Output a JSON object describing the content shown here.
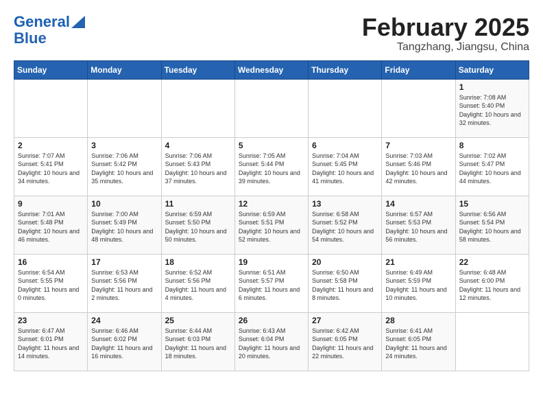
{
  "header": {
    "logo_line1": "General",
    "logo_line2": "Blue",
    "month_year": "February 2025",
    "location": "Tangzhang, Jiangsu, China"
  },
  "days_of_week": [
    "Sunday",
    "Monday",
    "Tuesday",
    "Wednesday",
    "Thursday",
    "Friday",
    "Saturday"
  ],
  "weeks": [
    [
      {
        "day": "",
        "info": ""
      },
      {
        "day": "",
        "info": ""
      },
      {
        "day": "",
        "info": ""
      },
      {
        "day": "",
        "info": ""
      },
      {
        "day": "",
        "info": ""
      },
      {
        "day": "",
        "info": ""
      },
      {
        "day": "1",
        "info": "Sunrise: 7:08 AM\nSunset: 5:40 PM\nDaylight: 10 hours and 32 minutes."
      }
    ],
    [
      {
        "day": "2",
        "info": "Sunrise: 7:07 AM\nSunset: 5:41 PM\nDaylight: 10 hours and 34 minutes."
      },
      {
        "day": "3",
        "info": "Sunrise: 7:06 AM\nSunset: 5:42 PM\nDaylight: 10 hours and 35 minutes."
      },
      {
        "day": "4",
        "info": "Sunrise: 7:06 AM\nSunset: 5:43 PM\nDaylight: 10 hours and 37 minutes."
      },
      {
        "day": "5",
        "info": "Sunrise: 7:05 AM\nSunset: 5:44 PM\nDaylight: 10 hours and 39 minutes."
      },
      {
        "day": "6",
        "info": "Sunrise: 7:04 AM\nSunset: 5:45 PM\nDaylight: 10 hours and 41 minutes."
      },
      {
        "day": "7",
        "info": "Sunrise: 7:03 AM\nSunset: 5:46 PM\nDaylight: 10 hours and 42 minutes."
      },
      {
        "day": "8",
        "info": "Sunrise: 7:02 AM\nSunset: 5:47 PM\nDaylight: 10 hours and 44 minutes."
      }
    ],
    [
      {
        "day": "9",
        "info": "Sunrise: 7:01 AM\nSunset: 5:48 PM\nDaylight: 10 hours and 46 minutes."
      },
      {
        "day": "10",
        "info": "Sunrise: 7:00 AM\nSunset: 5:49 PM\nDaylight: 10 hours and 48 minutes."
      },
      {
        "day": "11",
        "info": "Sunrise: 6:59 AM\nSunset: 5:50 PM\nDaylight: 10 hours and 50 minutes."
      },
      {
        "day": "12",
        "info": "Sunrise: 6:59 AM\nSunset: 5:51 PM\nDaylight: 10 hours and 52 minutes."
      },
      {
        "day": "13",
        "info": "Sunrise: 6:58 AM\nSunset: 5:52 PM\nDaylight: 10 hours and 54 minutes."
      },
      {
        "day": "14",
        "info": "Sunrise: 6:57 AM\nSunset: 5:53 PM\nDaylight: 10 hours and 56 minutes."
      },
      {
        "day": "15",
        "info": "Sunrise: 6:56 AM\nSunset: 5:54 PM\nDaylight: 10 hours and 58 minutes."
      }
    ],
    [
      {
        "day": "16",
        "info": "Sunrise: 6:54 AM\nSunset: 5:55 PM\nDaylight: 11 hours and 0 minutes."
      },
      {
        "day": "17",
        "info": "Sunrise: 6:53 AM\nSunset: 5:56 PM\nDaylight: 11 hours and 2 minutes."
      },
      {
        "day": "18",
        "info": "Sunrise: 6:52 AM\nSunset: 5:56 PM\nDaylight: 11 hours and 4 minutes."
      },
      {
        "day": "19",
        "info": "Sunrise: 6:51 AM\nSunset: 5:57 PM\nDaylight: 11 hours and 6 minutes."
      },
      {
        "day": "20",
        "info": "Sunrise: 6:50 AM\nSunset: 5:58 PM\nDaylight: 11 hours and 8 minutes."
      },
      {
        "day": "21",
        "info": "Sunrise: 6:49 AM\nSunset: 5:59 PM\nDaylight: 11 hours and 10 minutes."
      },
      {
        "day": "22",
        "info": "Sunrise: 6:48 AM\nSunset: 6:00 PM\nDaylight: 11 hours and 12 minutes."
      }
    ],
    [
      {
        "day": "23",
        "info": "Sunrise: 6:47 AM\nSunset: 6:01 PM\nDaylight: 11 hours and 14 minutes."
      },
      {
        "day": "24",
        "info": "Sunrise: 6:46 AM\nSunset: 6:02 PM\nDaylight: 11 hours and 16 minutes."
      },
      {
        "day": "25",
        "info": "Sunrise: 6:44 AM\nSunset: 6:03 PM\nDaylight: 11 hours and 18 minutes."
      },
      {
        "day": "26",
        "info": "Sunrise: 6:43 AM\nSunset: 6:04 PM\nDaylight: 11 hours and 20 minutes."
      },
      {
        "day": "27",
        "info": "Sunrise: 6:42 AM\nSunset: 6:05 PM\nDaylight: 11 hours and 22 minutes."
      },
      {
        "day": "28",
        "info": "Sunrise: 6:41 AM\nSunset: 6:05 PM\nDaylight: 11 hours and 24 minutes."
      },
      {
        "day": "",
        "info": ""
      }
    ]
  ]
}
